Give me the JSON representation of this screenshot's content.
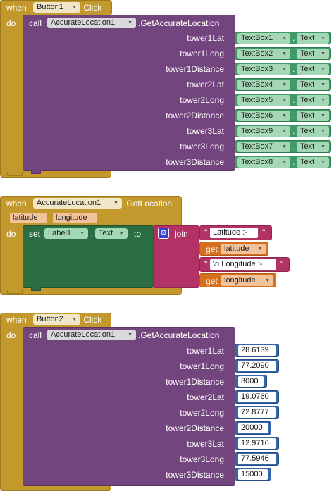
{
  "block1": {
    "when": "when",
    "component": "Button1",
    "event": ".Click",
    "do": "do",
    "call": "call",
    "procedure": "AccurateLocation1",
    "method": ".GetAccurateLocation",
    "args": [
      {
        "label": "tower1Lat",
        "component": "TextBox1",
        "property": "Text"
      },
      {
        "label": "tower1Long",
        "component": "TextBox2",
        "property": "Text"
      },
      {
        "label": "tower1Distance",
        "component": "TextBox3",
        "property": "Text"
      },
      {
        "label": "tower2Lat",
        "component": "TextBox4",
        "property": "Text"
      },
      {
        "label": "tower2Long",
        "component": "TextBox5",
        "property": "Text"
      },
      {
        "label": "tower2Distance",
        "component": "TextBox6",
        "property": "Text"
      },
      {
        "label": "tower3Lat",
        "component": "TextBox9",
        "property": "Text"
      },
      {
        "label": "tower3Long",
        "component": "TextBox7",
        "property": "Text"
      },
      {
        "label": "tower3Distance",
        "component": "TextBox8",
        "property": "Text"
      }
    ]
  },
  "block2": {
    "when": "when",
    "component": "AccurateLocation1",
    "event": ".GotLocation",
    "params": [
      "latitude",
      "longitude"
    ],
    "do": "do",
    "set": "set",
    "target": "Label1",
    "property": "Text",
    "to": "to",
    "join": "join",
    "items": [
      {
        "type": "text",
        "value": "Latitude :-"
      },
      {
        "type": "get",
        "keyword": "get",
        "value": "latitude"
      },
      {
        "type": "text",
        "value": "\\n Longitude :-"
      },
      {
        "type": "get",
        "keyword": "get",
        "value": "longitude"
      }
    ]
  },
  "block3": {
    "when": "when",
    "component": "Button2",
    "event": ".Click",
    "do": "do",
    "call": "call",
    "procedure": "AccurateLocation1",
    "method": ".GetAccurateLocation",
    "args": [
      {
        "label": "tower1Lat",
        "value": "28.6139"
      },
      {
        "label": "tower1Long",
        "value": "77.2090"
      },
      {
        "label": "tower1Distance",
        "value": "3000"
      },
      {
        "label": "tower2Lat",
        "value": "19.0760"
      },
      {
        "label": "tower2Long",
        "value": "72.8777"
      },
      {
        "label": "tower2Distance",
        "value": "20000"
      },
      {
        "label": "tower3Lat",
        "value": "12.9716"
      },
      {
        "label": "tower3Long",
        "value": "77.5946"
      },
      {
        "label": "tower3Distance",
        "value": "15000"
      }
    ]
  },
  "colors": {
    "event": "#c3992d",
    "procedure": "#73457e",
    "component": "#3f9a65",
    "setter": "#2c6e43",
    "math": "#3466a8",
    "text": "#b33266",
    "variable": "#d6701e"
  },
  "icons": {
    "dropdown": "chevron-down-icon",
    "mutator": "gear-icon"
  }
}
